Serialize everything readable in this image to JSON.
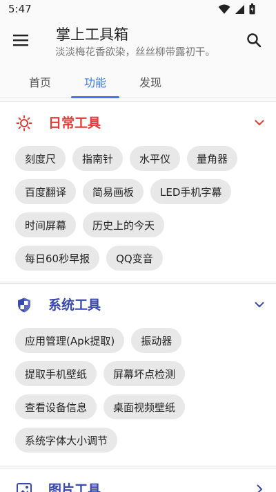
{
  "status": {
    "time": "5:47"
  },
  "header": {
    "title": "掌上工具箱",
    "subtitle": "淡淡梅花香欲染，丝丝柳带露初干。"
  },
  "tabs": [
    {
      "label": "首页"
    },
    {
      "label": "功能"
    },
    {
      "label": "发现"
    }
  ],
  "sections": [
    {
      "title": "日常工具",
      "color": "#e53935",
      "icon": "sun-icon",
      "expanded": true,
      "rows": [
        [
          "刻度尺",
          "指南针",
          "水平仪",
          "量角器"
        ],
        [
          "百度翻译",
          "简易画板",
          "LED手机字幕"
        ],
        [
          "时间屏幕",
          "历史上的今天"
        ],
        [
          "每日60秒早报",
          "QQ变音"
        ]
      ]
    },
    {
      "title": "系统工具",
      "color": "#3949ab",
      "icon": "shield-icon",
      "expanded": true,
      "rows": [
        [
          "应用管理(Apk提取)",
          "振动器"
        ],
        [
          "提取手机壁纸",
          "屏幕坏点检测"
        ],
        [
          "查看设备信息",
          "桌面视频壁纸"
        ],
        [
          "系统字体大小调节"
        ]
      ]
    },
    {
      "title": "图片工具",
      "color": "#3949ab",
      "icon": "image-icon",
      "expanded": false
    }
  ],
  "accent": "#3a7be8"
}
